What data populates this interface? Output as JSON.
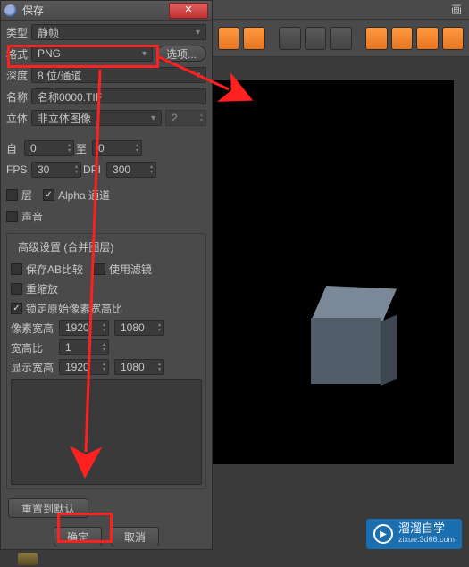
{
  "dialog": {
    "title": "保存",
    "close": "✕",
    "rows": {
      "type_label": "类型",
      "type_value": "静帧",
      "format_label": "格式",
      "format_value": "PNG",
      "options_btn": "选项...",
      "depth_label": "深度",
      "depth_value": "8 位/通道",
      "name_label": "名称",
      "name_value": "名称0000.TIF",
      "stereo_label": "立体",
      "stereo_value": "非立体图像",
      "stereo_count": "2",
      "from_label": "自",
      "from_value": "0",
      "to_label": "至",
      "to_value": "0",
      "fps_label": "FPS",
      "fps_value": "30",
      "dpi_label": "DPI",
      "dpi_value": "300",
      "layer_cb": "层",
      "alpha_cb": "Alpha 通道",
      "sound_cb": "声音"
    },
    "advanced": {
      "legend": "高级设置 (合并图层)",
      "save_ab": "保存AB比较",
      "use_filter": "使用滤镜",
      "rescale": "重缩放",
      "lock_ratio": "锁定原始像素宽高比",
      "px_wh_label": "像素宽高",
      "px_w": "1920",
      "px_h": "1080",
      "aspect_label": "宽高比",
      "aspect_value": "1",
      "disp_wh_label": "显示宽高",
      "disp_w": "1920",
      "disp_h": "1080"
    },
    "reset_btn": "重置到默认",
    "ok_btn": "确定",
    "cancel_btn": "取消"
  },
  "viewport": {
    "title": "画"
  },
  "watermark": {
    "brand": "溜溜自学",
    "url": "zixue.3d66.com"
  }
}
